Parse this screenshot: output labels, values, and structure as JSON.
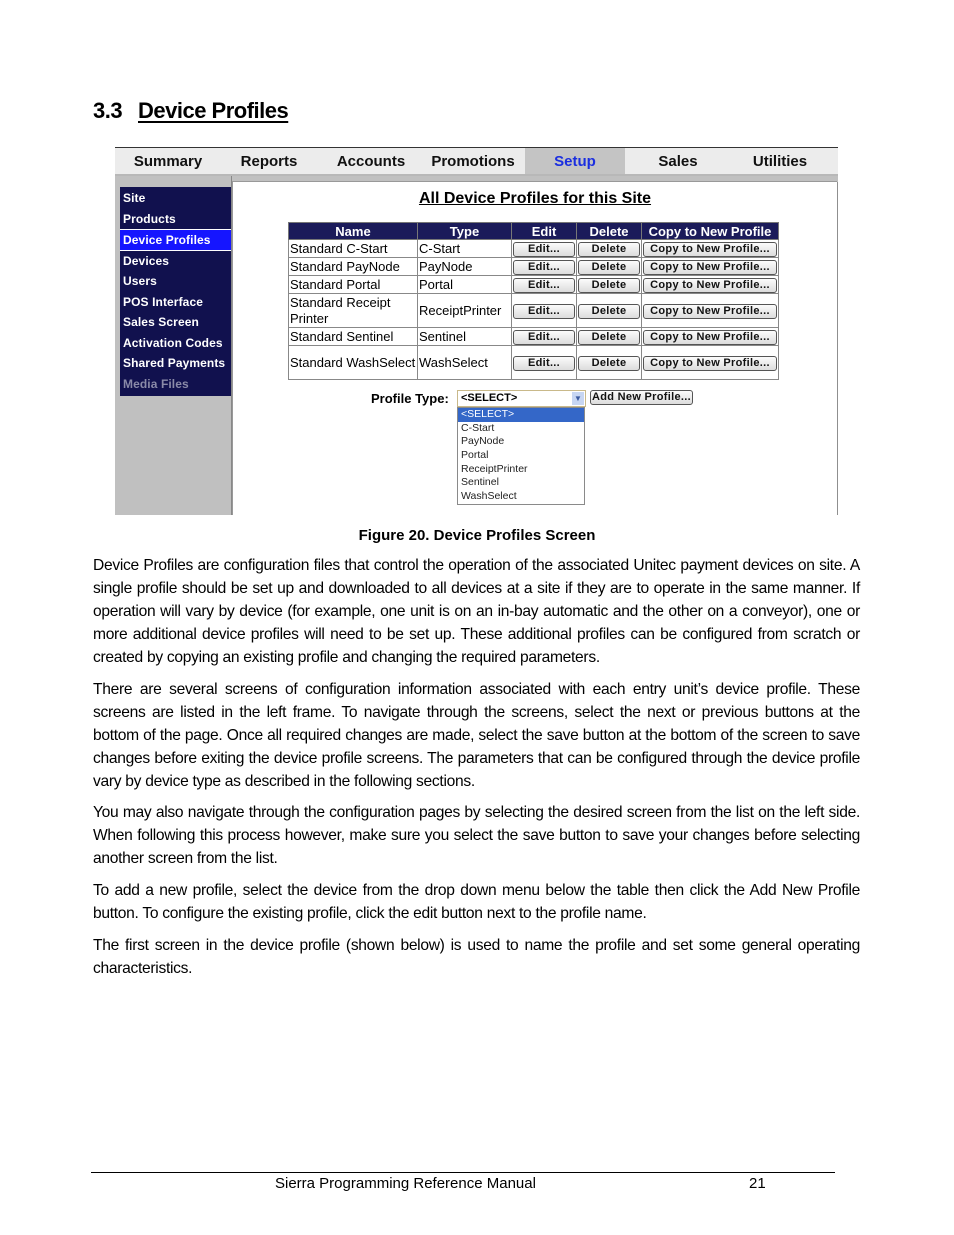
{
  "section": {
    "number": "3.3",
    "title": "Device Profiles"
  },
  "screenshot": {
    "top_nav": {
      "tabs": [
        {
          "label": "Summary",
          "active": false
        },
        {
          "label": "Reports",
          "active": false
        },
        {
          "label": "Accounts",
          "active": false
        },
        {
          "label": "Promotions",
          "active": false
        },
        {
          "label": "Setup",
          "active": true
        },
        {
          "label": "Sales",
          "active": false
        },
        {
          "label": "Utilities",
          "active": false
        }
      ]
    },
    "sidebar": {
      "items": [
        {
          "label": "Site",
          "state": "normal"
        },
        {
          "label": "Products",
          "state": "normal"
        },
        {
          "label": "Device Profiles",
          "state": "active"
        },
        {
          "label": "Devices",
          "state": "normal"
        },
        {
          "label": "Users",
          "state": "normal"
        },
        {
          "label": "POS Interface",
          "state": "normal"
        },
        {
          "label": "Sales Screen",
          "state": "normal"
        },
        {
          "label": "Activation Codes",
          "state": "normal"
        },
        {
          "label": "Shared Payments",
          "state": "normal"
        },
        {
          "label": "Media Files",
          "state": "disabled"
        }
      ]
    },
    "main": {
      "title": "All Device Profiles for this Site",
      "table": {
        "columns": [
          "Name",
          "Type",
          "Edit",
          "Delete",
          "Copy to New Profile"
        ],
        "rows": [
          {
            "name": "Standard C-Start",
            "type": "C-Start"
          },
          {
            "name": "Standard PayNode",
            "type": "PayNode"
          },
          {
            "name": "Standard Portal",
            "type": "Portal"
          },
          {
            "name": "Standard Receipt Printer",
            "type": "ReceiptPrinter"
          },
          {
            "name": "Standard Sentinel",
            "type": "Sentinel"
          },
          {
            "name": "Standard WashSelect",
            "type": "WashSelect"
          }
        ],
        "edit_label": "Edit...",
        "delete_label": "Delete",
        "copy_label": "Copy to New Profile..."
      },
      "profile_type": {
        "label": "Profile Type:",
        "selected": "<SELECT>",
        "options": [
          "<SELECT>",
          "C-Start",
          "PayNode",
          "Portal",
          "ReceiptPrinter",
          "Sentinel",
          "WashSelect"
        ],
        "highlighted_option": "<SELECT>"
      },
      "add_button_label": "Add New Profile..."
    }
  },
  "figure_caption": "Figure 20. Device Profiles Screen",
  "paragraphs": [
    "Device Profiles are configuration files that control the operation of the associated Unitec payment devices on site. A single profile should be set up and downloaded to all devices at a site if they are to operate in the same manner. If operation will vary by device (for example, one unit is on an in-bay automatic and the other on a conveyor), one or more additional device profiles will need to be set up. These additional profiles can be configured from scratch or created by copying an existing profile and changing the required parameters.",
    "There are several screens of configuration information associated with each entry unit’s device profile. These screens are listed in the left frame. To navigate through the screens, select the next or previous buttons at the bottom of the page. Once all required changes are made, select the save button at the bottom of the screen to save changes before exiting the device profile screens. The parameters that can be configured through the device profile vary by device type as described in the following sections.",
    "You may also navigate through the configuration pages by selecting the desired screen from the list on the left side. When following this process however, make sure you select the save button to save your changes before selecting another screen from the list.",
    "To add a new profile, select the device from the drop down menu below the table then click the Add New Profile button. To configure the existing profile, click the edit button next to the profile name.",
    "The first screen in the device profile (shown below) is used to name the profile and set some general operating characteristics."
  ],
  "footer": {
    "title": "Sierra Programming Reference Manual",
    "page": "21"
  }
}
